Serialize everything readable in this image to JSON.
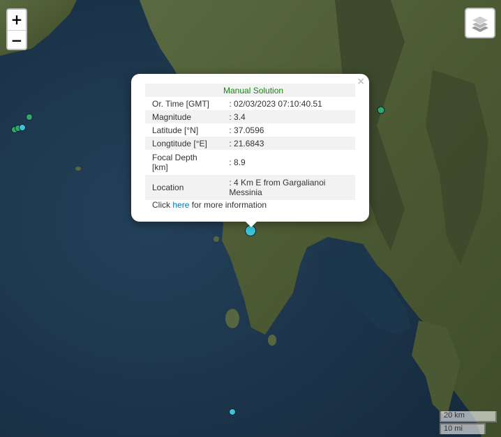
{
  "controls": {
    "zoom_in": "+",
    "zoom_out": "−",
    "layers_icon": "layers-icon"
  },
  "popup": {
    "close": "×",
    "title": "Manual Solution",
    "rows": [
      {
        "label": "Or. Time [GMT]",
        "value": ": 02/03/2023 07:10:40.51"
      },
      {
        "label": "Magnitude",
        "value": ": 3.4"
      },
      {
        "label": "Latitude [°N]",
        "value": ": 37.0596"
      },
      {
        "label": "Longtitude [°E]",
        "value": ": 21.6843"
      },
      {
        "label": "Focal Depth\n[km]",
        "value": ": 8.9"
      },
      {
        "label": "Location",
        "value": ": 4 Km E from Gargalianoi\nMessinia"
      }
    ],
    "more_prefix": "Click ",
    "more_link": "here",
    "more_suffix": " for more information"
  },
  "scale": {
    "km": "20 km",
    "mi": "10 mi"
  },
  "colors": {
    "sea": "#1b3449",
    "land": "#51603a",
    "mountain": "#3e4a2a",
    "event_recent": "#3cc3d6",
    "event_older": "#2fa86a"
  }
}
